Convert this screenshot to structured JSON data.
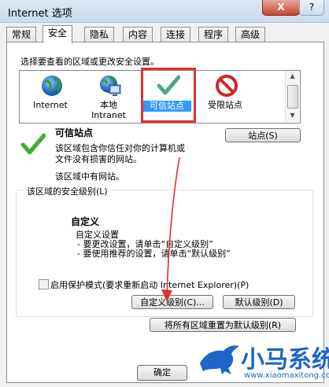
{
  "window": {
    "title": "Internet 选项",
    "close_label": "X",
    "help_label": "?"
  },
  "tabs": [
    "常规",
    "安全",
    "隐私",
    "内容",
    "连接",
    "程序",
    "高级"
  ],
  "active_tab": "安全",
  "zones_prompt": "选择要查看的区域或更改安全设置。",
  "zones": [
    {
      "label": "Internet",
      "icon": "globe-icon"
    },
    {
      "label": "本地",
      "label2": "Intranet",
      "icon": "local-intranet-icon"
    },
    {
      "label": "可信站点",
      "icon": "checkmark-icon",
      "selected": true
    },
    {
      "label": "受限站点",
      "icon": "no-entry-icon"
    }
  ],
  "zone_detail": {
    "title": "可信站点",
    "desc1": "该区域包含你信任对你的计算机或",
    "desc2": "文件没有损害的网站。",
    "has_sites": "该区域中有网站。",
    "sites_button": "站点(S)"
  },
  "security_level": {
    "group_label": "该区域的安全级别(L)",
    "level_name": "自定义",
    "line1": "自定义设置",
    "line2": "- 要更改设置，请单击“自定义级别”",
    "line3": "- 要使用推荐的设置，请单击“默认级别”",
    "protected_mode": "启用保护模式(要求重新启动 Internet Explorer)(P)",
    "protected_mode_checked": false,
    "custom_level_button": "自定义级别(C)...",
    "default_level_button": "默认级别(D)",
    "reset_all_button": "将所有区域重置为默认级别(R)"
  },
  "ok_button": "确定",
  "brand": {
    "name": "小马系统",
    "url": "www.xiaomaxitong.com"
  },
  "colors": {
    "accent": "#3399ff",
    "highlight": "#e8302c",
    "brand_blue": "#1f64c8"
  }
}
